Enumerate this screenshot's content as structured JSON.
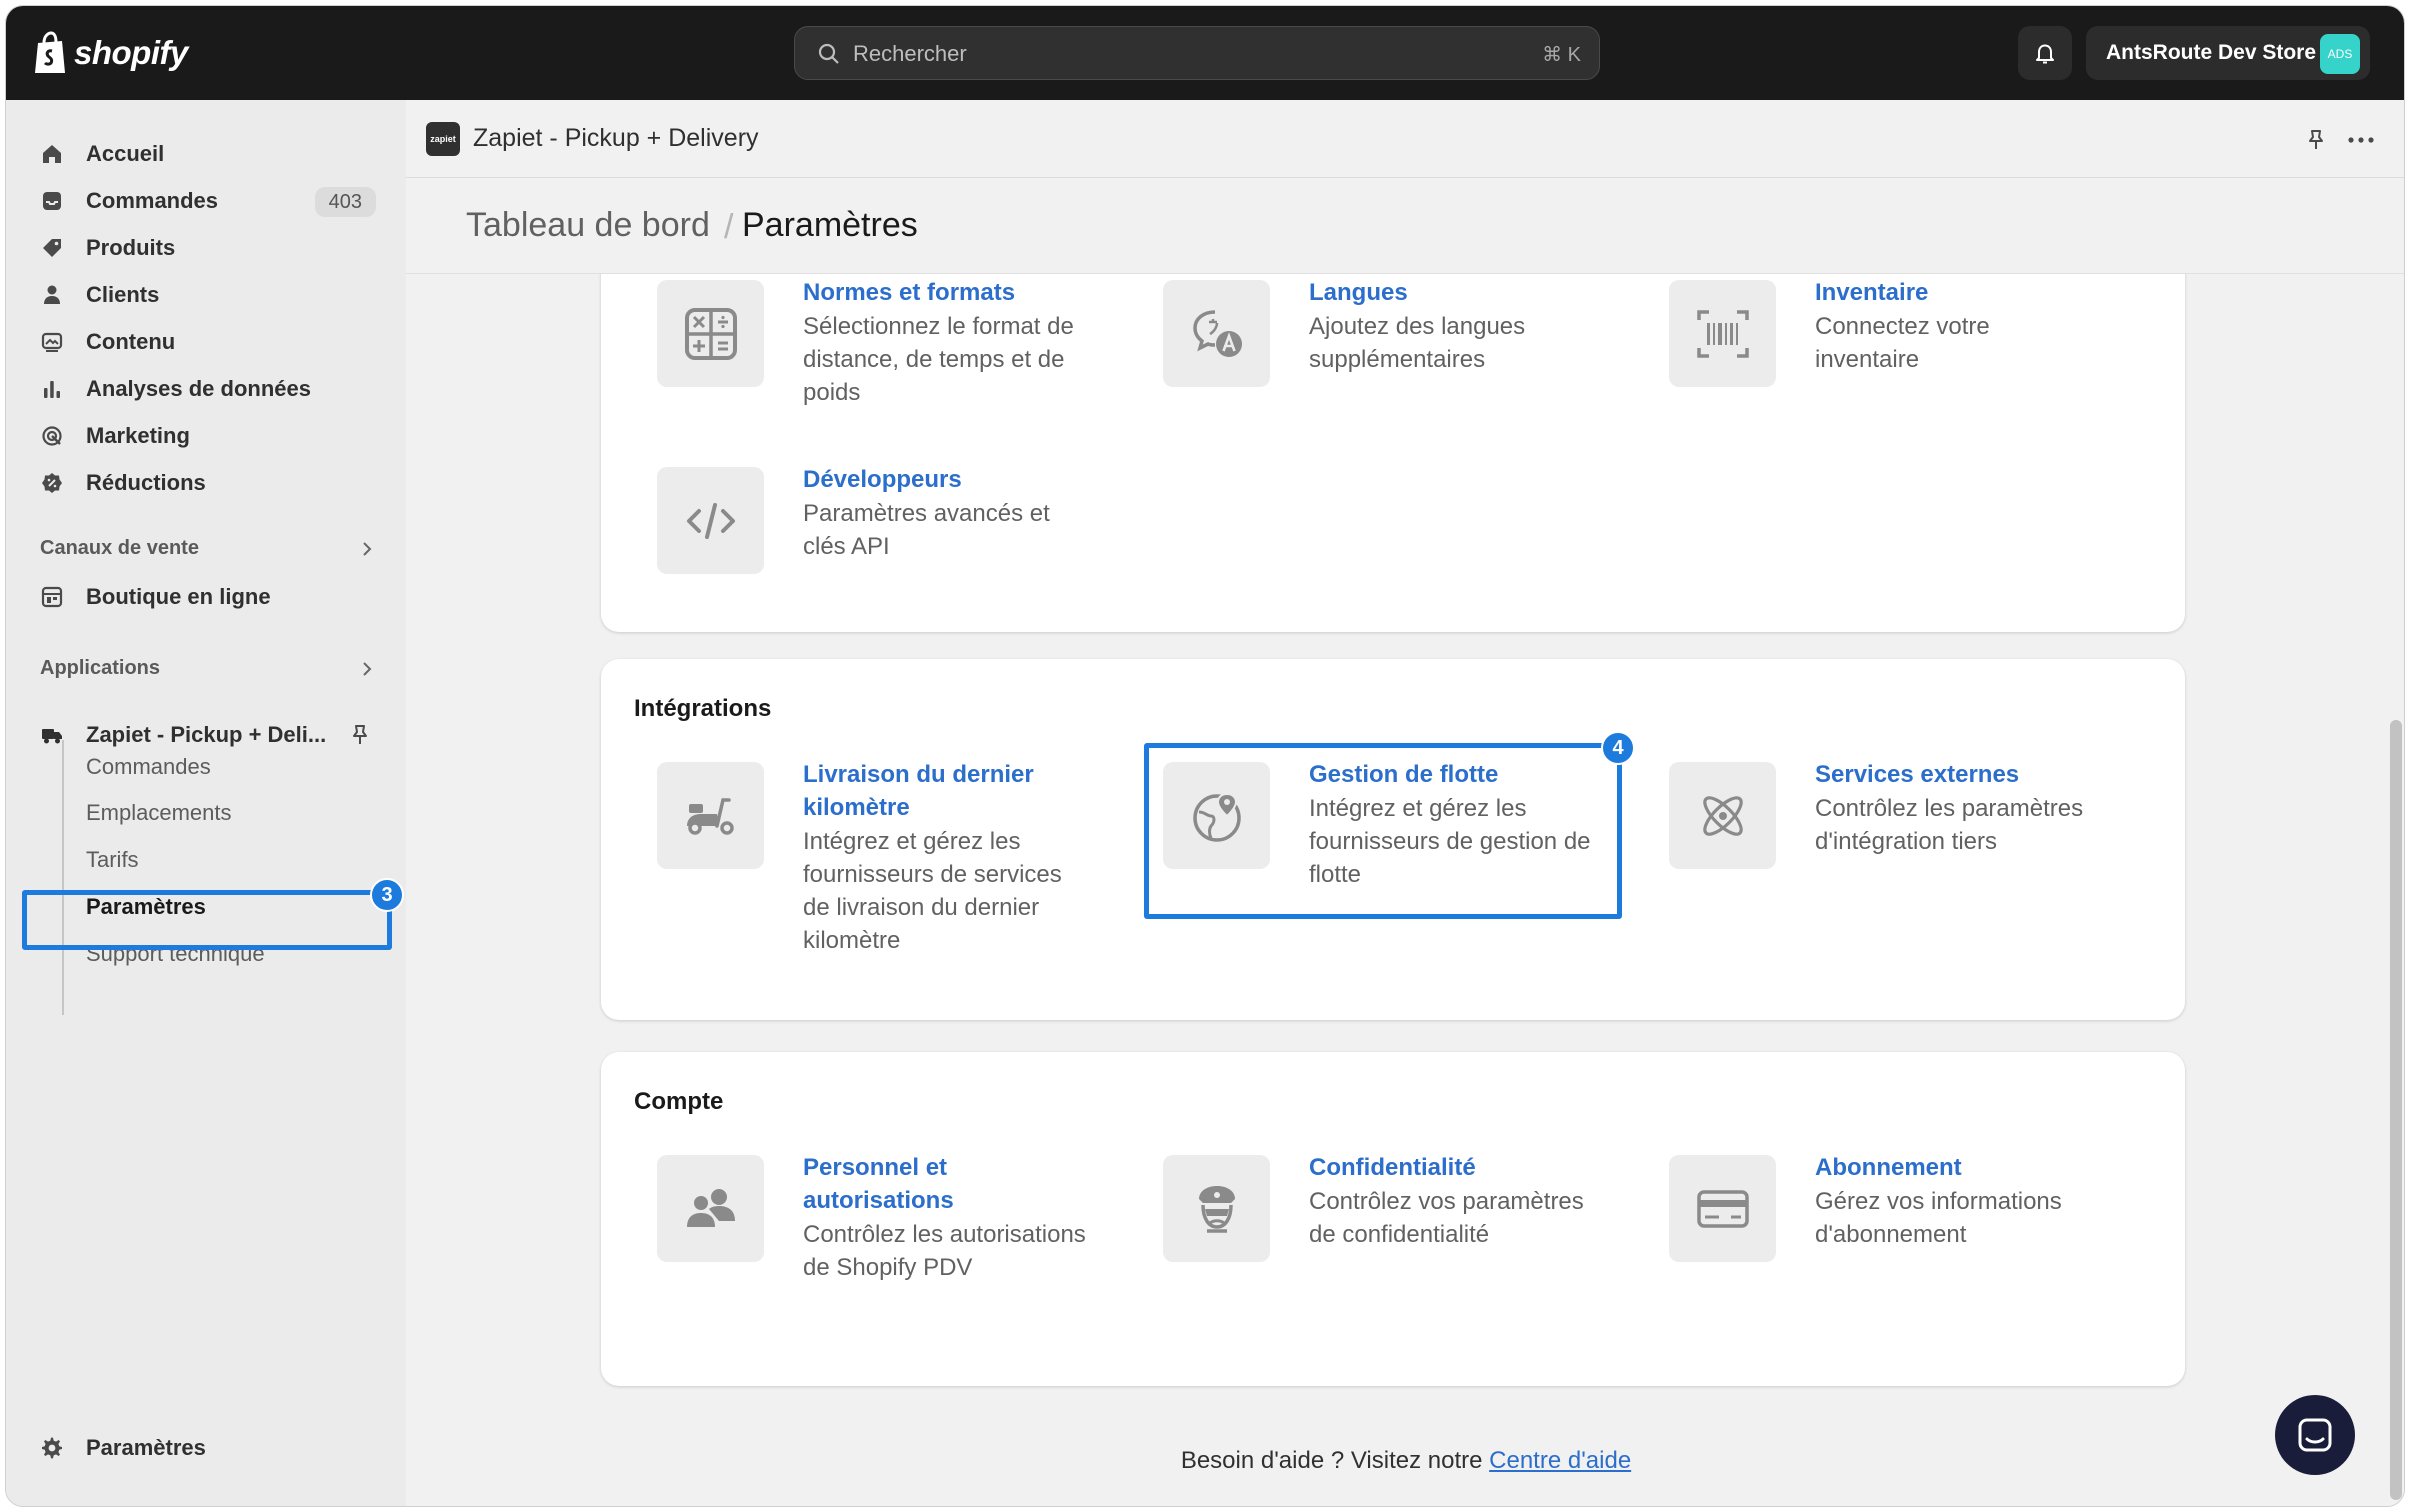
{
  "topbar": {
    "brand": "shopify",
    "search_placeholder": "Rechercher",
    "search_shortcut": "⌘ K",
    "store_name": "AntsRoute Dev Store",
    "store_avatar": "ADS"
  },
  "sidebar": {
    "items": [
      {
        "label": "Accueil",
        "icon": "home-icon"
      },
      {
        "label": "Commandes",
        "icon": "orders-icon",
        "badge": "403"
      },
      {
        "label": "Produits",
        "icon": "tag-icon"
      },
      {
        "label": "Clients",
        "icon": "person-icon"
      },
      {
        "label": "Contenu",
        "icon": "content-icon"
      },
      {
        "label": "Analyses de données",
        "icon": "bar-chart-icon"
      },
      {
        "label": "Marketing",
        "icon": "target-icon"
      },
      {
        "label": "Réductions",
        "icon": "discount-icon"
      }
    ],
    "sales_channels_heading": "Canaux de vente",
    "online_store": "Boutique en ligne",
    "apps_heading": "Applications",
    "app_name": "Zapiet - Pickup + Deli...",
    "app_subitems": [
      "Commandes",
      "Emplacements",
      "Tarifs",
      "Paramètres",
      "Support technique"
    ],
    "settings": "Paramètres",
    "step_badge": "3"
  },
  "app_header": {
    "app_icon_text": "zapiet",
    "title": "Zapiet - Pickup + Delivery"
  },
  "page_header": {
    "crumb": "Tableau de bord",
    "sep": "/",
    "title": "Paramètres"
  },
  "cards": {
    "general": {
      "items": [
        {
          "title": "Normes et formats",
          "desc": "Sélectionnez le format de distance, de temps et de poids",
          "icon": "calculator-icon"
        },
        {
          "title": "Langues",
          "desc": "Ajoutez des langues supplémentaires",
          "icon": "language-icon"
        },
        {
          "title": "Inventaire",
          "desc": "Connectez votre inventaire",
          "icon": "barcode-icon"
        },
        {
          "title": "Développeurs",
          "desc": "Paramètres avancés et clés API",
          "icon": "code-icon"
        }
      ]
    },
    "integrations": {
      "heading": "Intégrations",
      "items": [
        {
          "title": "Livraison du dernier kilomètre",
          "desc": "Intégrez et gérez les fournisseurs de services de livraison du dernier kilomètre",
          "icon": "scooter-icon"
        },
        {
          "title": "Gestion de flotte",
          "desc": "Intégrez et gérez les fournisseurs de gestion de flotte",
          "icon": "globe-pin-icon"
        },
        {
          "title": "Services externes",
          "desc": "Contrôlez les paramètres d'intégration tiers",
          "icon": "atom-icon"
        }
      ],
      "step_badge": "4"
    },
    "account": {
      "heading": "Compte",
      "items": [
        {
          "title": "Personnel et autorisations",
          "desc": "Contrôlez les autorisations de Shopify PDV",
          "icon": "people-icon"
        },
        {
          "title": "Confidentialité",
          "desc": "Contrôlez vos paramètres de confidentialité",
          "icon": "privacy-officer-icon"
        },
        {
          "title": "Abonnement",
          "desc": "Gérez vos informations d'abonnement",
          "icon": "credit-card-icon"
        }
      ]
    }
  },
  "help": {
    "text": "Besoin d'aide ? Visitez notre ",
    "link": "Centre d'aide"
  },
  "colors": {
    "link": "#2c6ecb",
    "highlight": "#1c7bdc",
    "topbar": "#1a1a1a"
  }
}
